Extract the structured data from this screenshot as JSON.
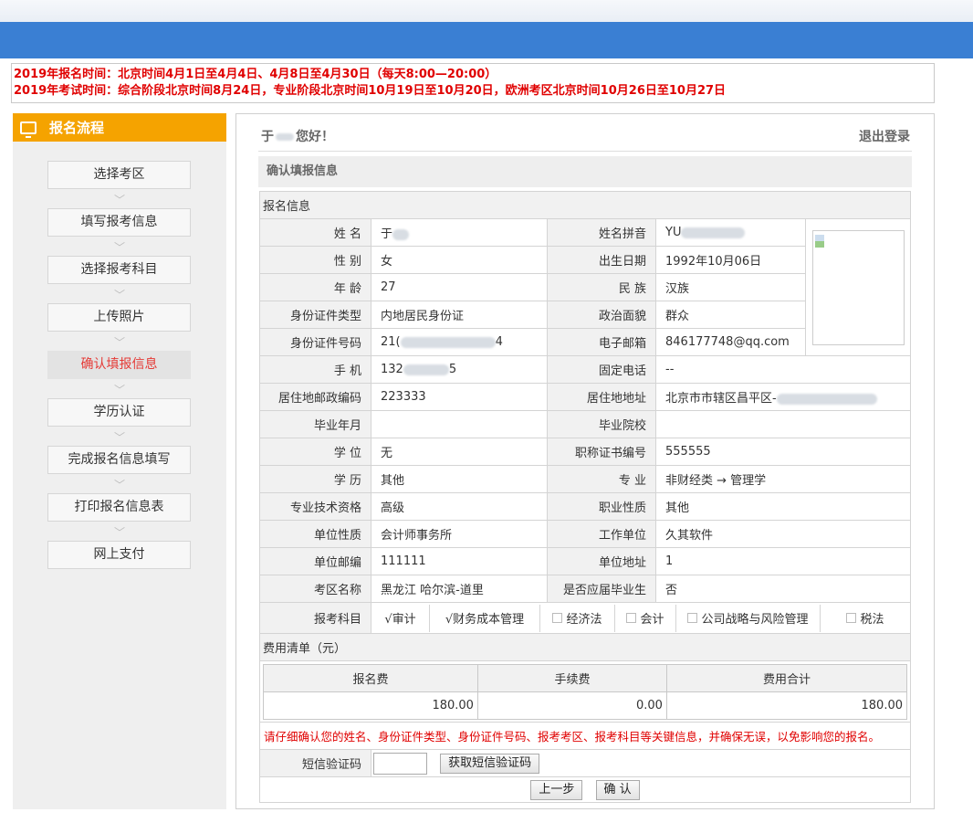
{
  "notice": {
    "line1": "2019年报名时间：北京时间4月1日至4月4日、4月8日至4月30日（每天8:00—20:00）",
    "line2": "2019年考试时间：综合阶段北京时间8月24日，专业阶段北京时间10月19日至10月20日，欧洲考区北京时间10月26日至10月27日"
  },
  "sidebar": {
    "title": "报名流程",
    "steps": [
      "选择考区",
      "填写报考信息",
      "选择报考科目",
      "上传照片",
      "确认填报信息",
      "学历认证",
      "完成报名信息填写",
      "打印报名信息表",
      "网上支付"
    ],
    "active_index": 4
  },
  "header": {
    "greeting_prefix": "于",
    "greeting_suffix": "您好！",
    "logout": "退出登录"
  },
  "section_title": "确认填报信息",
  "info": {
    "group_title": "报名信息",
    "name_label": "姓 名",
    "name_value": "于",
    "pinyin_label": "姓名拼音",
    "pinyin_value": "YU",
    "gender_label": "性 别",
    "gender_value": "女",
    "birth_label": "出生日期",
    "birth_value": "1992年10月06日",
    "age_label": "年 龄",
    "age_value": "27",
    "ethnic_label": "民 族",
    "ethnic_value": "汉族",
    "idtype_label": "身份证件类型",
    "idtype_value": "内地居民身份证",
    "politics_label": "政治面貌",
    "politics_value": "群众",
    "idno_label": "身份证件号码",
    "idno_prefix": "21(",
    "idno_suffix": "4",
    "email_label": "电子邮箱",
    "email_value": "846177748@qq.com",
    "mobile_label": "手 机",
    "mobile_prefix": "132",
    "mobile_suffix": "5",
    "phone_label": "固定电话",
    "phone_value": "--",
    "zip_label": "居住地邮政编码",
    "zip_value": "223333",
    "address_label": "居住地地址",
    "address_value": "北京市市辖区昌平区-",
    "gradyear_label": "毕业年月",
    "gradyear_value": "",
    "school_label": "毕业院校",
    "school_value": "",
    "degree_label": "学 位",
    "degree_value": "无",
    "cert_label": "职称证书编号",
    "cert_value": "555555",
    "edu_label": "学 历",
    "edu_value": "其他",
    "major_label": "专 业",
    "major_value": "非财经类 → 管理学",
    "qual_label": "专业技术资格",
    "qual_value": "高级",
    "job_label": "职业性质",
    "job_value": "其他",
    "orgtype_label": "单位性质",
    "orgtype_value": "会计师事务所",
    "org_label": "工作单位",
    "org_value": "久其软件",
    "orgzip_label": "单位邮编",
    "orgzip_value": "111111",
    "orgaddr_label": "单位地址",
    "orgaddr_value": "1",
    "area_label": "考区名称",
    "area_value": "黑龙江 哈尔滨-道里",
    "fresh_label": "是否应届毕业生",
    "fresh_value": "否",
    "subjects_label": "报考科目",
    "subjects": [
      {
        "label": "√审计",
        "checked": true
      },
      {
        "label": "√财务成本管理",
        "checked": true
      },
      {
        "label": "经济法",
        "checked": false
      },
      {
        "label": "会计",
        "checked": false
      },
      {
        "label": "公司战略与风险管理",
        "checked": false
      },
      {
        "label": "税法",
        "checked": false
      }
    ]
  },
  "fees": {
    "title": "费用清单（元）",
    "headers": [
      "报名费",
      "手续费",
      "费用合计"
    ],
    "values": [
      "180.00",
      "0.00",
      "180.00"
    ]
  },
  "warning": "请仔细确认您的姓名、身份证件类型、身份证件号码、报考考区、报考科目等关键信息，并确保无误，以免影响您的报名。",
  "sms": {
    "label": "短信验证码",
    "value": "",
    "button": "获取短信验证码"
  },
  "buttons": {
    "prev": "上一步",
    "confirm": "确 认"
  }
}
